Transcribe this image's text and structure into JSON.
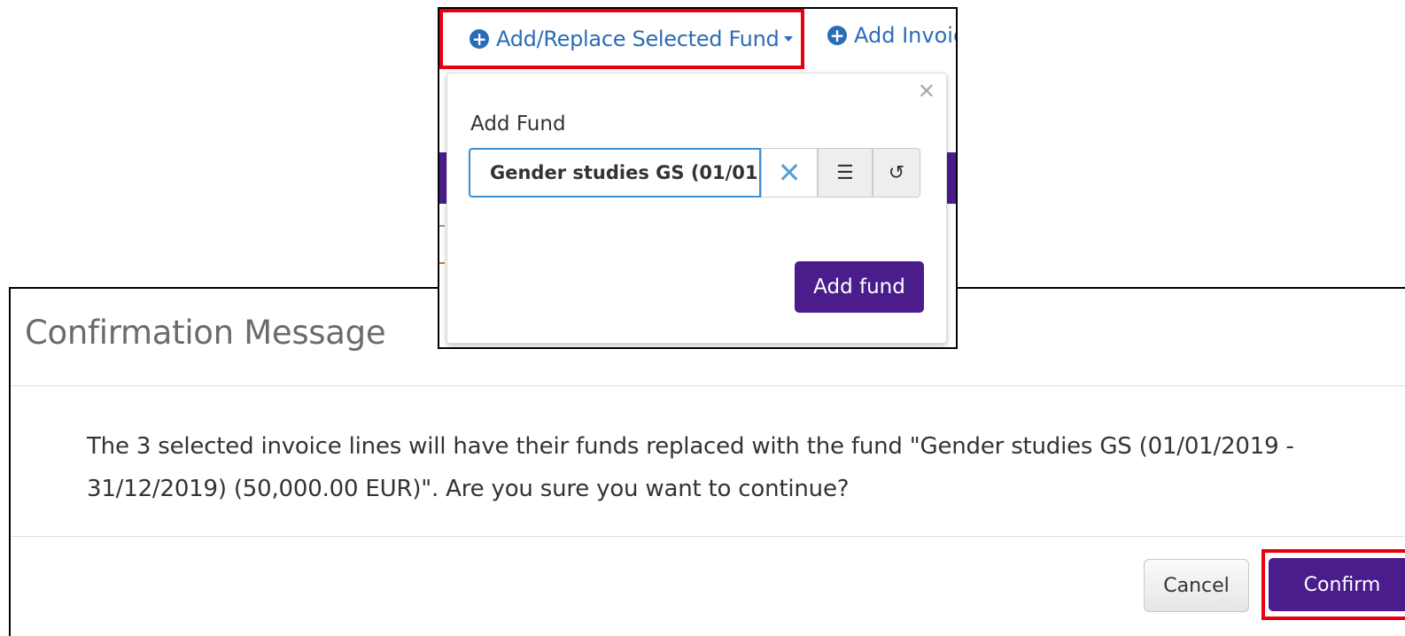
{
  "dialog": {
    "title": "Confirmation Message",
    "message": "The 3 selected invoice lines will have their funds replaced with the fund \"Gender studies GS (01/01/2019 - 31/12/2019) (50,000.00 EUR)\". Are you sure you want to continue?",
    "cancel_label": "Cancel",
    "confirm_label": "Confirm"
  },
  "toolbar": {
    "fund_menu_label": "Add/Replace Selected Fund",
    "add_invoice_label": "Add Invoic"
  },
  "fund_popup": {
    "label": "Add Fund",
    "fund_value": "Gender studies GS (01/01",
    "add_button_label": "Add fund"
  },
  "icons": {
    "plus": "plus-circle-icon",
    "clear": "clear-x-icon",
    "list": "list-icon",
    "history": "history-icon",
    "close": "close-icon"
  },
  "colors": {
    "primary_purple": "#4a1c8c",
    "link_blue": "#2b6cb8",
    "highlight_red": "#e8000f"
  }
}
